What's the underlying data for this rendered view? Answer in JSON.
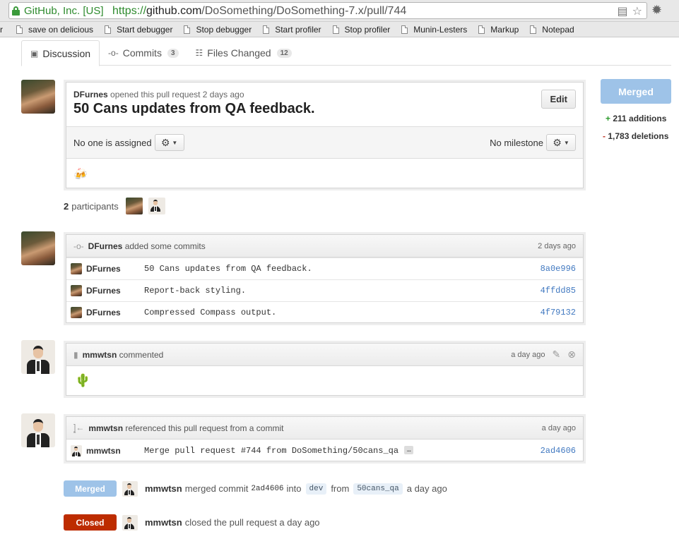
{
  "browser": {
    "ssl_label": "GitHub, Inc. [US]",
    "url_protocol": "https://",
    "url_host": "github.com",
    "url_path": "/DoSomething/DoSomething-7.x/pull/744",
    "bookmarks": [
      "r",
      "save on delicious",
      "Start debugger",
      "Stop debugger",
      "Start profiler",
      "Stop profiler",
      "Munin-Lesters",
      "Markup",
      "Notepad"
    ]
  },
  "tabs": {
    "discussion": "Discussion",
    "commits": "Commits",
    "commits_count": "3",
    "files": "Files Changed",
    "files_count": "12"
  },
  "pr": {
    "author": "DFurnes",
    "opened_text": "opened this pull request 2 days ago",
    "title": "50 Cans updates from QA feedback.",
    "edit_label": "Edit",
    "assignee_text": "No one is assigned",
    "milestone_text": "No milestone",
    "emoji": "🍻",
    "participants_count": "2",
    "participants_label": "participants"
  },
  "sidebar": {
    "merged_label": "Merged",
    "additions": "211 additions",
    "deletions": "1,783 deletions",
    "plus": "+",
    "minus": "-"
  },
  "commits_event": {
    "author": "DFurnes",
    "action": "added some commits",
    "time": "2 days ago",
    "rows": [
      {
        "author": "DFurnes",
        "message": "50 Cans updates from QA feedback.",
        "sha": "8a0e996"
      },
      {
        "author": "DFurnes",
        "message": "Report-back styling.",
        "sha": "4ffdd85"
      },
      {
        "author": "DFurnes",
        "message": "Compressed Compass output.",
        "sha": "4f79132"
      }
    ]
  },
  "comment": {
    "author": "mmwtsn",
    "action": "commented",
    "time": "a day ago",
    "emoji": "🌵"
  },
  "reference": {
    "author": "mmwtsn",
    "action": "referenced this pull request from a commit",
    "time": "a day ago",
    "row_author": "mmwtsn",
    "message": "Merge pull request #744 from DoSomething/50cans_qa",
    "ellipsis": "…",
    "sha": "2ad4606"
  },
  "merge_event": {
    "badge": "Merged",
    "author": "mmwtsn",
    "text1": "merged commit",
    "sha": "2ad4606",
    "text2": "into",
    "target": "dev",
    "text3": "from",
    "source": "50cans_qa",
    "time": "a day ago"
  },
  "close_event": {
    "badge": "Closed",
    "author": "mmwtsn",
    "text": "closed the pull request a day ago"
  },
  "colors": {
    "link_blue": "#4078c0",
    "merged_blue": "#9ec3e8",
    "closed_red": "#bd2c00",
    "addition_green": "#2d9b2d"
  }
}
